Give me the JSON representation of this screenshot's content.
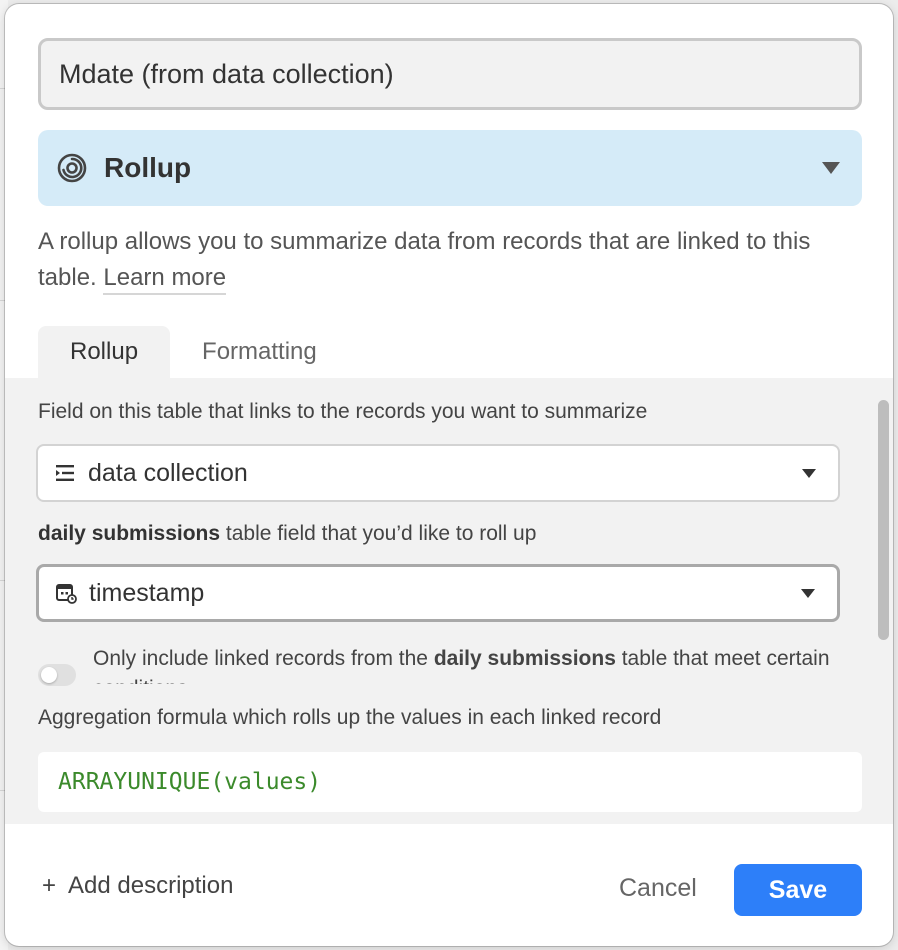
{
  "field_name": "Mdate (from data collection)",
  "type_select": {
    "label": "Rollup",
    "icon": "rollup-spiral-icon",
    "bg_color": "#d5ebf8"
  },
  "description": {
    "text": "A rollup allows you to summarize data from records that are linked to this table.",
    "learn_more": "Learn more"
  },
  "tabs": [
    {
      "label": "Rollup",
      "active": true
    },
    {
      "label": "Formatting",
      "active": false
    }
  ],
  "linked_field": {
    "label": "Field on this table that links to the records you want to summarize",
    "value": "data collection",
    "icon": "linked-records-icon"
  },
  "rollup_field": {
    "label_bold": "daily submissions",
    "label_rest": " table field that you’d like to roll up",
    "value": "timestamp",
    "icon": "date-field-icon"
  },
  "condition_toggle": {
    "on": false,
    "text_before": "Only include linked records from the ",
    "text_bold": "daily submissions",
    "text_after": " table that meet certain conditions"
  },
  "aggregation": {
    "label": "Aggregation formula which rolls up the values in each linked record",
    "formula": "ARRAYUNIQUE(values)",
    "formula_color": "#3b8a2b"
  },
  "footer": {
    "add_description": "Add description",
    "cancel": "Cancel",
    "save": "Save",
    "save_color": "#2d7ff9"
  }
}
